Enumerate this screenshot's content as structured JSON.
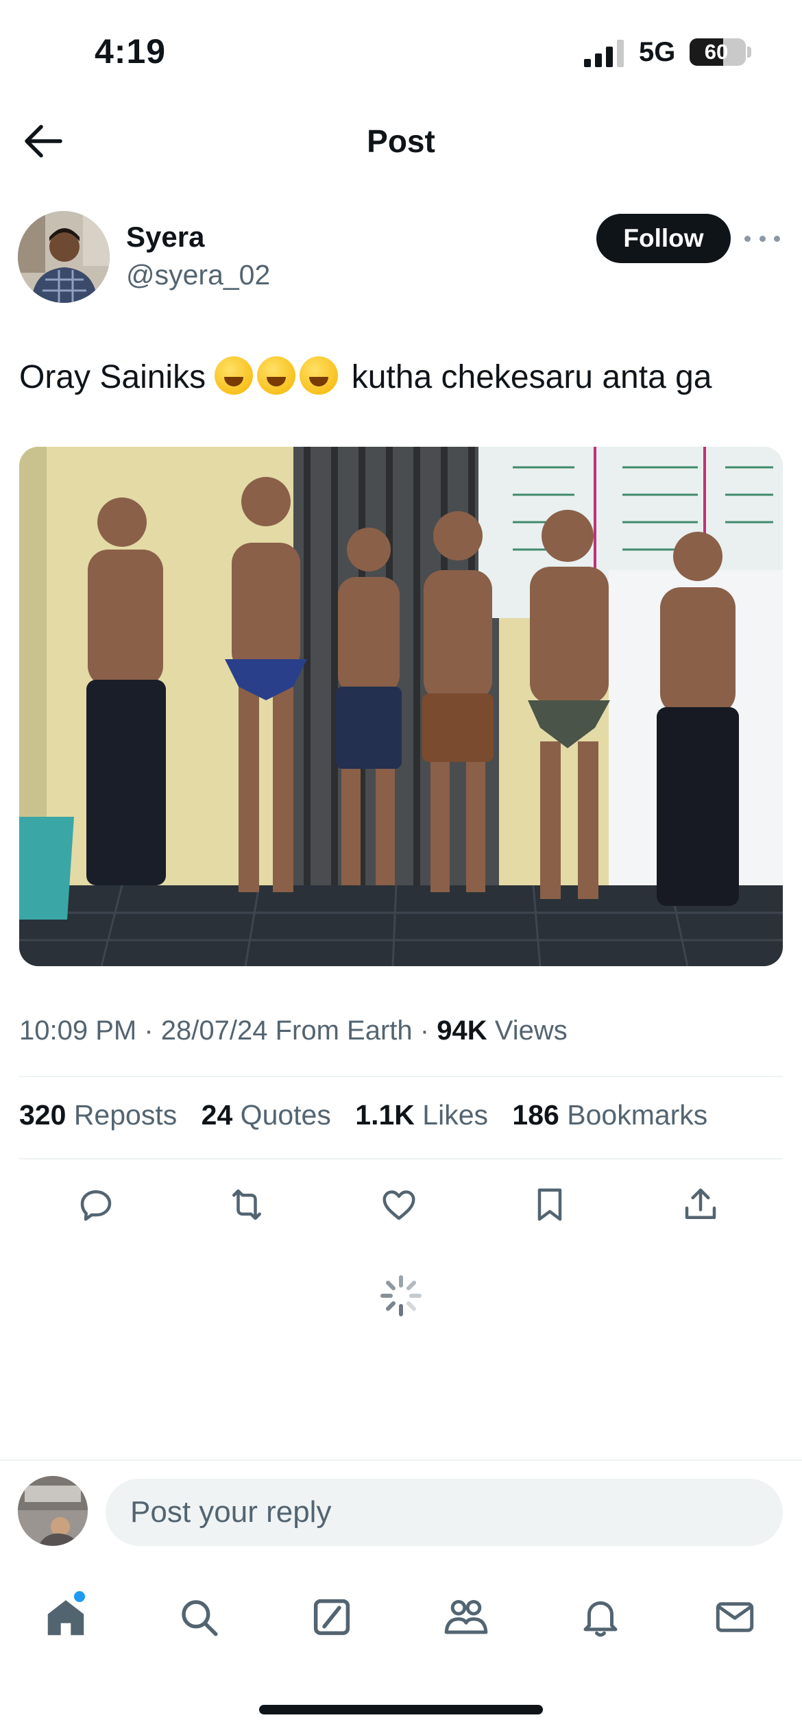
{
  "status_bar": {
    "time": "4:19",
    "network": "5G",
    "battery": "60",
    "battery_level": 0.6
  },
  "header": {
    "title": "Post"
  },
  "author": {
    "name": "Syera",
    "handle": "@syera_02",
    "follow_label": "Follow"
  },
  "tweet": {
    "text_before": "Oray Sainiks",
    "text_after": "kutha chekesaru anta ga",
    "emoji_name": "rolling-on-the-floor-laughing",
    "emoji_count": 3
  },
  "meta": {
    "time": "10:09 PM",
    "date": "28/07/24",
    "source": "From Earth",
    "views_count": "94K",
    "views_label": "Views"
  },
  "stats": [
    {
      "count": "320",
      "label": "Reposts"
    },
    {
      "count": "24",
      "label": "Quotes"
    },
    {
      "count": "1.1K",
      "label": "Likes"
    },
    {
      "count": "186",
      "label": "Bookmarks"
    }
  ],
  "actions": [
    "reply-icon",
    "repost-icon",
    "like-icon",
    "bookmark-icon",
    "share-icon"
  ],
  "reply": {
    "placeholder": "Post your reply"
  },
  "tabbar": [
    "home-icon",
    "search-icon",
    "grok-icon",
    "communities-icon",
    "notifications-icon",
    "messages-icon"
  ],
  "colors": {
    "accent": "#1d9bf0",
    "text": "#0f1419",
    "secondary": "#536471",
    "divider": "#eff3f4"
  }
}
